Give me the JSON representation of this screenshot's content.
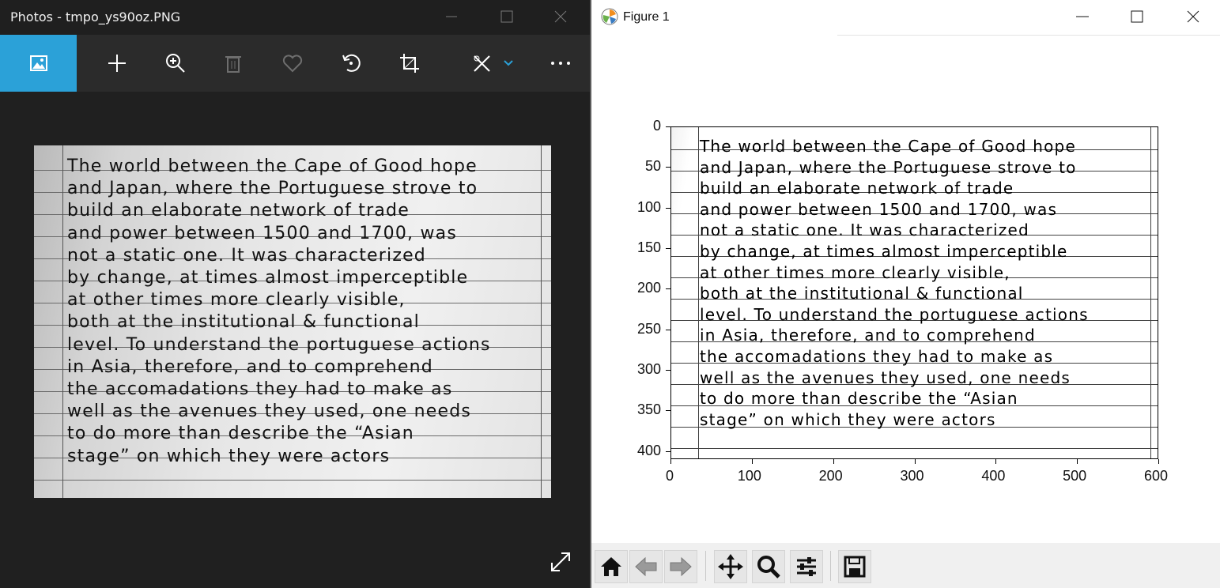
{
  "photos": {
    "title": "Photos - tmpo_ys90oz.PNG",
    "toolbar": {
      "items": [
        "image-view-icon",
        "add-icon",
        "zoom-in-icon",
        "delete-icon",
        "favorite-icon",
        "rotate-icon",
        "crop-icon",
        "edit-create-icon",
        "chevron-down-icon",
        "more-icon"
      ]
    },
    "accent_color": "#2ba1d8"
  },
  "document_text": {
    "lines": [
      "The world between the Cape of Good hope",
      "and Japan, where the Portuguese strove to",
      "build an elaborate network of trade",
      "and power between 1500 and 1700, was",
      "not a static one. It was characterized",
      "by change, at times almost imperceptible",
      "at other times more clearly visible,",
      "both at the institutional & functional",
      "level. To understand the portuguese actions",
      "in Asia, therefore, and to comprehend",
      "the accomadations they had to make as",
      "well as the avenues they used, one needs",
      "to do more than describe the “Asian",
      "stage” on which they were actors"
    ]
  },
  "figure": {
    "title": "Figure 1",
    "y_ticks": [
      "0",
      "50",
      "100",
      "150",
      "200",
      "250",
      "300",
      "350",
      "400"
    ],
    "x_ticks": [
      "0",
      "100",
      "200",
      "300",
      "400",
      "500",
      "600"
    ],
    "navbar": [
      "home-icon",
      "back-icon",
      "forward-icon",
      "pan-icon",
      "zoom-icon",
      "configure-subplots-icon",
      "save-icon"
    ]
  },
  "chart_data": {
    "type": "image",
    "xlim": [
      0,
      600
    ],
    "ylim": [
      410,
      0
    ],
    "x_ticks": [
      0,
      100,
      200,
      300,
      400,
      500,
      600
    ],
    "y_ticks": [
      0,
      50,
      100,
      150,
      200,
      250,
      300,
      350,
      400
    ],
    "grid": false
  }
}
